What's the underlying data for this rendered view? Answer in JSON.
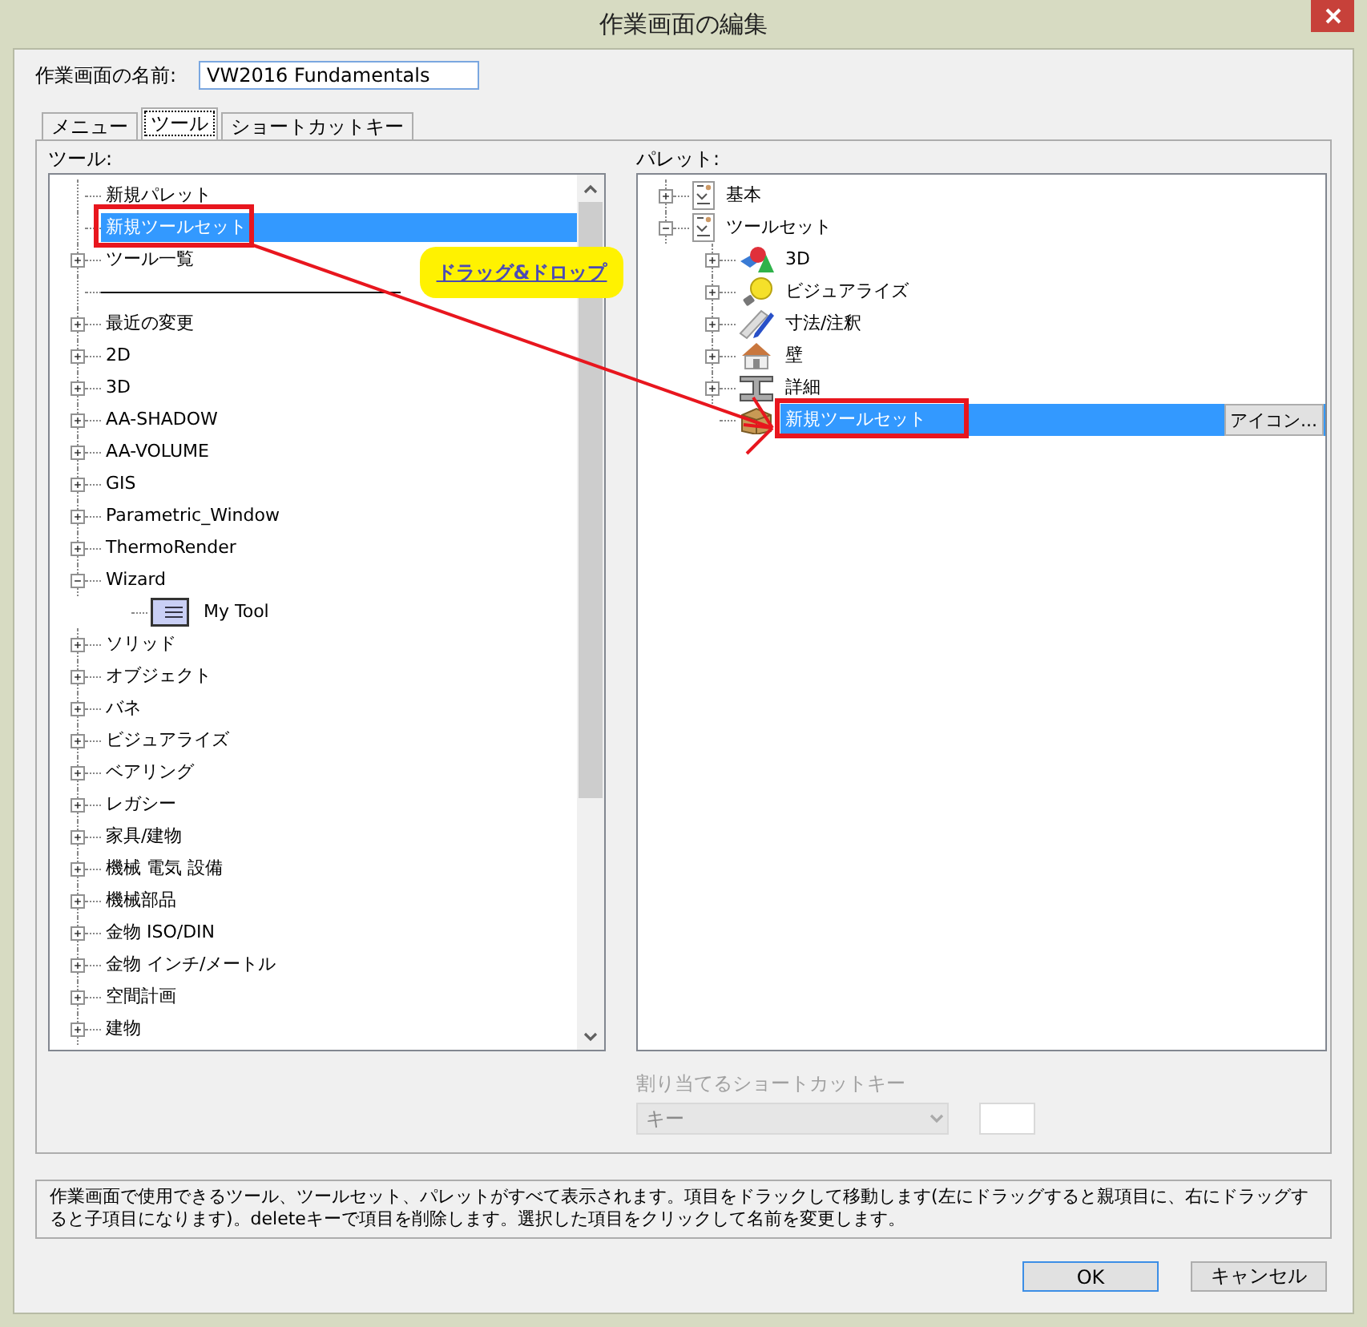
{
  "window": {
    "title": "作業画面の編集"
  },
  "name_field": {
    "label": "作業画面の名前:",
    "value": "VW2016 Fundamentals"
  },
  "tabs": [
    {
      "label": "メニュー",
      "selected": false
    },
    {
      "label": "ツール",
      "selected": true
    },
    {
      "label": "ショートカットキー",
      "selected": false
    }
  ],
  "tools_panel": {
    "label": "ツール:",
    "items": [
      {
        "label": "新規パレット",
        "kind": "item",
        "selected": false
      },
      {
        "label": "新規ツールセット",
        "kind": "item",
        "selected": true
      },
      {
        "label": "ツール一覧",
        "kind": "group",
        "expanded": false,
        "selected": false
      },
      {
        "kind": "separator"
      },
      {
        "label": "最近の変更",
        "kind": "group",
        "expanded": false,
        "selected": false
      },
      {
        "label": "2D",
        "kind": "group",
        "expanded": false,
        "selected": false
      },
      {
        "label": "3D",
        "kind": "group",
        "expanded": false,
        "selected": false
      },
      {
        "label": "AA-SHADOW",
        "kind": "group",
        "expanded": false,
        "selected": false
      },
      {
        "label": "AA-VOLUME",
        "kind": "group",
        "expanded": false,
        "selected": false
      },
      {
        "label": "GIS",
        "kind": "group",
        "expanded": false,
        "selected": false
      },
      {
        "label": "Parametric_Window",
        "kind": "group",
        "expanded": false,
        "selected": false
      },
      {
        "label": "ThermoRender",
        "kind": "group",
        "expanded": false,
        "selected": false
      },
      {
        "label": "Wizard",
        "kind": "group",
        "expanded": true,
        "selected": false,
        "children": [
          {
            "label": "My Tool",
            "kind": "tool",
            "selected": false
          }
        ]
      },
      {
        "label": "ソリッド",
        "kind": "group",
        "expanded": false,
        "selected": false
      },
      {
        "label": "オブジェクト",
        "kind": "group",
        "expanded": false,
        "selected": false
      },
      {
        "label": "バネ",
        "kind": "group",
        "expanded": false,
        "selected": false
      },
      {
        "label": "ビジュアライズ",
        "kind": "group",
        "expanded": false,
        "selected": false
      },
      {
        "label": "ベアリング",
        "kind": "group",
        "expanded": false,
        "selected": false
      },
      {
        "label": "レガシー",
        "kind": "group",
        "expanded": false,
        "selected": false
      },
      {
        "label": "家具/建物",
        "kind": "group",
        "expanded": false,
        "selected": false
      },
      {
        "label": "機械 電気 設備",
        "kind": "group",
        "expanded": false,
        "selected": false
      },
      {
        "label": "機械部品",
        "kind": "group",
        "expanded": false,
        "selected": false
      },
      {
        "label": "金物 ISO/DIN",
        "kind": "group",
        "expanded": false,
        "selected": false
      },
      {
        "label": "金物 インチ/メートル",
        "kind": "group",
        "expanded": false,
        "selected": false
      },
      {
        "label": "空間計画",
        "kind": "group",
        "expanded": false,
        "selected": false
      },
      {
        "label": "建物",
        "kind": "group",
        "expanded": false,
        "selected": false
      }
    ]
  },
  "palette_panel": {
    "label": "パレット:",
    "items": [
      {
        "label": "基本",
        "kind": "palette",
        "expanded": false,
        "selected": false
      },
      {
        "label": "ツールセット",
        "kind": "palette",
        "expanded": true,
        "selected": false,
        "children": [
          {
            "label": "3D",
            "kind": "shapes",
            "expanded": false,
            "selected": false
          },
          {
            "label": "ビジュアライズ",
            "kind": "bulb",
            "expanded": false,
            "selected": false
          },
          {
            "label": "寸法/注釈",
            "kind": "pencil",
            "expanded": false,
            "selected": false
          },
          {
            "label": "壁",
            "kind": "house",
            "expanded": false,
            "selected": false
          },
          {
            "label": "詳細",
            "kind": "beam",
            "expanded": false,
            "selected": false
          },
          {
            "label": "新規ツールセット",
            "kind": "box",
            "selected": true,
            "button": "アイコン..."
          }
        ]
      }
    ]
  },
  "shortcut": {
    "label": "割り当てるショートカットキー",
    "select_value": "キー",
    "disabled": true
  },
  "help_text": "作業画面で使用できるツール、ツールセット、パレットがすべて表示されます。項目をドラックして移動します(左にドラッグすると親項目に、右にドラッグすると子項目になります)。deleteキーで項目を削除します。選択した項目をクリックして名前を変更します。",
  "buttons": [
    {
      "label": "OK",
      "default": true
    },
    {
      "label": "キャンセル",
      "default": false
    }
  ],
  "annotation": {
    "callout": "ドラッグ&ドロップ"
  }
}
